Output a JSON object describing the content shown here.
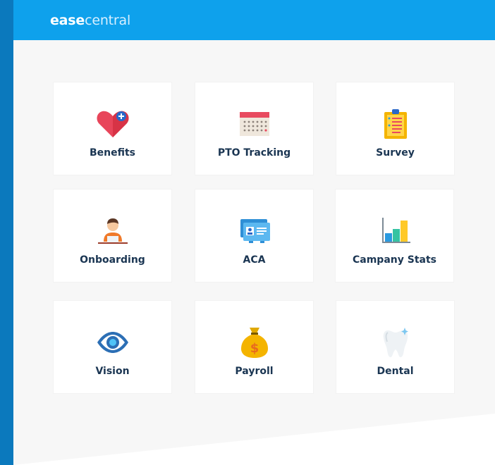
{
  "header": {
    "logo_part1": "ease",
    "logo_part2": "central"
  },
  "tiles": [
    {
      "label": "Benefits",
      "icon": "heart-plus-icon"
    },
    {
      "label": "PTO Tracking",
      "icon": "calendar-icon"
    },
    {
      "label": "Survey",
      "icon": "clipboard-icon"
    },
    {
      "label": "Onboarding",
      "icon": "person-laptop-icon"
    },
    {
      "label": "ACA",
      "icon": "id-card-icon"
    },
    {
      "label": "Campany Stats",
      "icon": "bar-chart-icon"
    },
    {
      "label": "Vision",
      "icon": "eye-icon"
    },
    {
      "label": "Payroll",
      "icon": "money-bag-icon"
    },
    {
      "label": "Dental",
      "icon": "tooth-icon"
    }
  ],
  "colors": {
    "header": "#0ea1ec",
    "background": "#f7f7f7",
    "label": "#1a3552"
  }
}
